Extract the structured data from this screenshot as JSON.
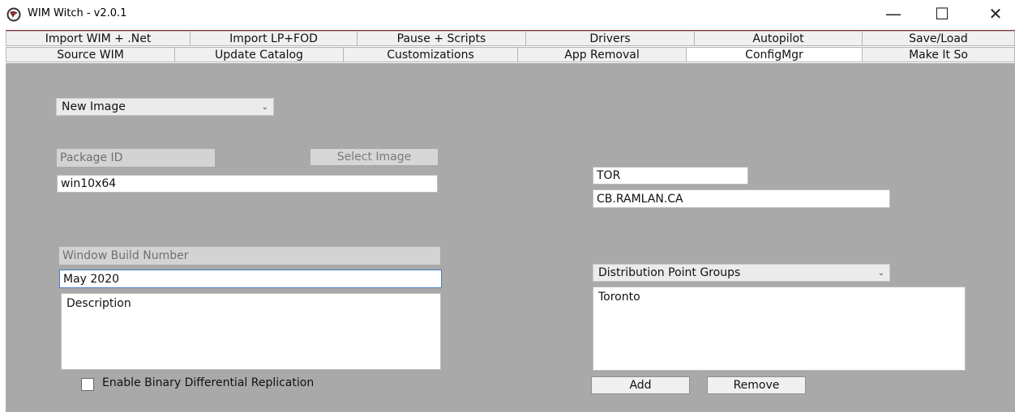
{
  "window": {
    "title": "WIM Witch - v2.0.1",
    "minimize_glyph": "—",
    "maximize_glyph": "☐",
    "close_glyph": "✕"
  },
  "tabs_row1": [
    "Import WIM + .Net",
    "Import LP+FOD",
    "Pause + Scripts",
    "Drivers",
    "Autopilot",
    "Save/Load"
  ],
  "tabs_row2": [
    "Source WIM",
    "Update Catalog",
    "Customizations",
    "App Removal",
    "ConfigMgr",
    "Make It So"
  ],
  "active_tab": "ConfigMgr",
  "configmgr": {
    "image_mode": "New Image",
    "package_id_label": "Package ID",
    "select_image_button": "Select Image",
    "package_id_value": "win10x64",
    "site_code": "TOR",
    "site_server": "CB.RAMLAN.CA",
    "build_number_label": "Window Build Number",
    "build_number_value": "May 2020",
    "description_value": "Description",
    "dp_type": "Distribution Point Groups",
    "dp_list": [
      "Toronto"
    ],
    "add_button": "Add",
    "remove_button": "Remove",
    "binary_diff_label": "Enable Binary Differential Replication",
    "binary_diff_checked": false
  },
  "colors": {
    "accent": "#8a2f35",
    "panel_bg": "#a9a9a9"
  }
}
